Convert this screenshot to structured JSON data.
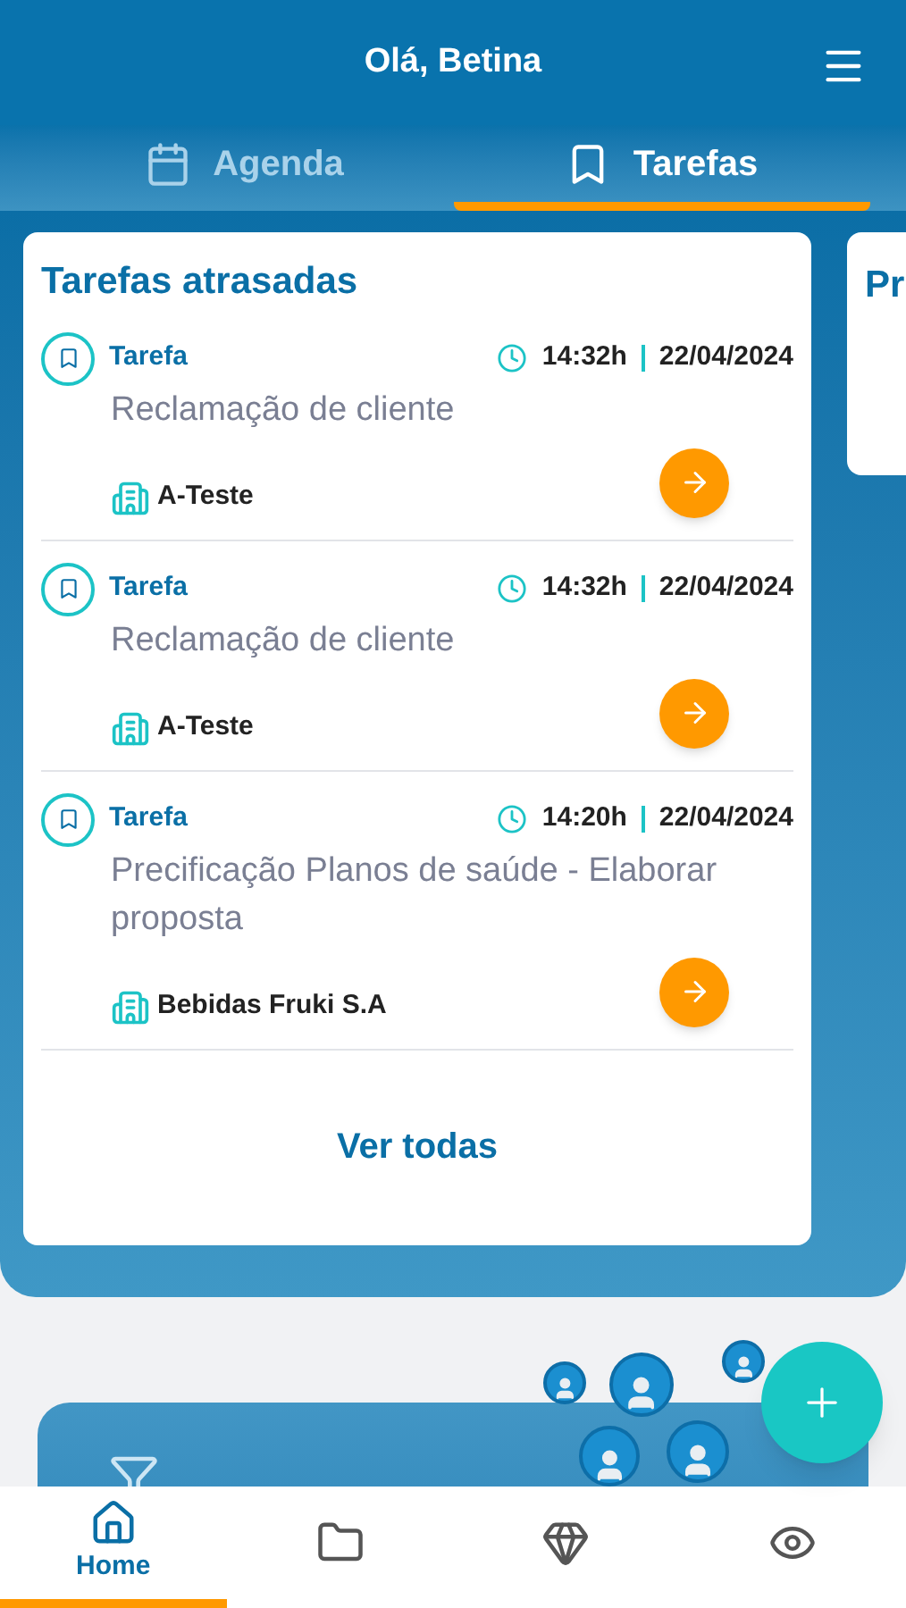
{
  "header": {
    "greeting": "Olá, Betina"
  },
  "tabs": [
    {
      "label": "Agenda",
      "selected": false
    },
    {
      "label": "Tarefas",
      "selected": true
    }
  ],
  "cards": [
    {
      "title": "Tarefas atrasadas",
      "link": "Ver todas",
      "items": [
        {
          "type": "Tarefa",
          "time": "14:32h",
          "date": "22/04/2024",
          "description": "Reclamação de cliente",
          "company": "A-Teste"
        },
        {
          "type": "Tarefa",
          "time": "14:32h",
          "date": "22/04/2024",
          "description": "Reclamação de cliente",
          "company": "A-Teste"
        },
        {
          "type": "Tarefa",
          "time": "14:20h",
          "date": "22/04/2024",
          "description": "Precificação Planos de saúde - Elaborar proposta",
          "company": "Bebidas Fruki S.A"
        }
      ]
    },
    {
      "title": "Pr"
    }
  ],
  "bottom_nav": [
    {
      "label": "Home",
      "selected": true
    },
    {
      "selected": false
    },
    {
      "selected": false
    },
    {
      "selected": false
    }
  ]
}
